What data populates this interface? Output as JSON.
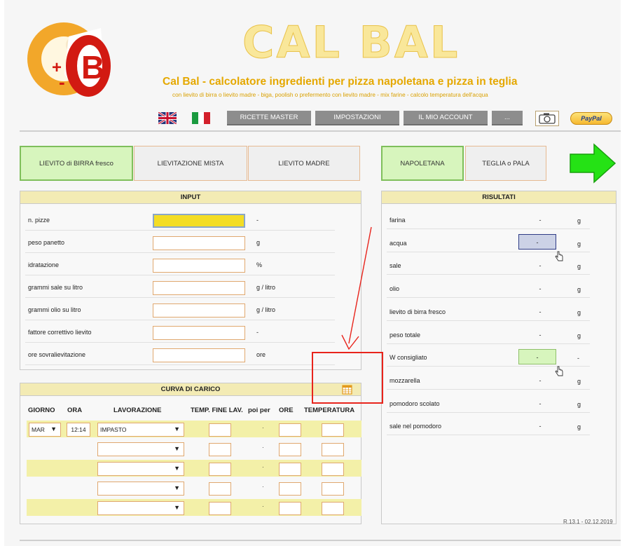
{
  "header": {
    "big_title": "CAL BAL",
    "subtitle": "Cal Bal - calcolatore ingredienti per pizza napoletana e pizza in teglia",
    "subtitle2": "con lievito di birra o lievito madre - biga, poolish o prefermento con lievito madre - mix farine - calcolo temperatura dell'acqua"
  },
  "nav": {
    "ricette_master": "RICETTE MASTER",
    "impostazioni": "IMPOSTAZIONI",
    "mio_account": "IL MIO ACCOUNT",
    "more": "...",
    "paypal": "PayPal"
  },
  "tabs": {
    "lievito_birra": "LIEVITO di BIRRA fresco",
    "lievitazione_mista": "LIEVITAZIONE MISTA",
    "lievito_madre": "LIEVITO MADRE",
    "napoletana": "NAPOLETANA",
    "teglia": "TEGLIA o PALA"
  },
  "input": {
    "title": "INPUT",
    "rows": [
      {
        "label": "n. pizze",
        "unit": "-"
      },
      {
        "label": "peso panetto",
        "unit": "g"
      },
      {
        "label": "idratazione",
        "unit": "%"
      },
      {
        "label": "grammi sale su litro",
        "unit": "g / litro"
      },
      {
        "label": "grammi olio su litro",
        "unit": "g / litro"
      },
      {
        "label": "fattore correttivo lievito",
        "unit": "-"
      },
      {
        "label": "ore sovralievitazione",
        "unit": "ore"
      }
    ]
  },
  "risultati": {
    "title": "RISULTATI",
    "rows": [
      {
        "label": "farina",
        "value": "-",
        "unit": "g"
      },
      {
        "label": "acqua",
        "value": "-",
        "unit": "g"
      },
      {
        "label": "sale",
        "value": "-",
        "unit": "g"
      },
      {
        "label": "olio",
        "value": "-",
        "unit": "g"
      },
      {
        "label": "lievito di birra fresco",
        "value": "-",
        "unit": "g"
      },
      {
        "label": "peso totale",
        "value": "-",
        "unit": "g"
      },
      {
        "label": "W consigliato",
        "value": "-",
        "unit": "-"
      },
      {
        "label": "mozzarella",
        "value": "-",
        "unit": "g"
      },
      {
        "label": "pomodoro scolato",
        "value": "-",
        "unit": "g"
      },
      {
        "label": "sale nel pomodoro",
        "value": "-",
        "unit": "g"
      }
    ]
  },
  "curva": {
    "title": "CURVA DI CARICO",
    "headers": {
      "giorno": "GIORNO",
      "ora": "ORA",
      "lavorazione": "LAVORAZIONE",
      "temp_fine": "TEMP. FINE LAV.",
      "poi_per": "poi per",
      "ore": "ORE",
      "temperatura": "TEMPERATURA"
    },
    "row1": {
      "giorno": "MAR",
      "ora": "12:14",
      "lavorazione": "IMPASTO"
    },
    "dot": "·",
    "dropdown_arrow": "▼"
  },
  "version": "R.13.1 - 02.12.2019",
  "colors": {
    "accent_yellow": "#e5a800",
    "tab_active": "#d7f5bd",
    "nav_gray": "#8d8d8d",
    "annotation_red": "#e8241c"
  }
}
